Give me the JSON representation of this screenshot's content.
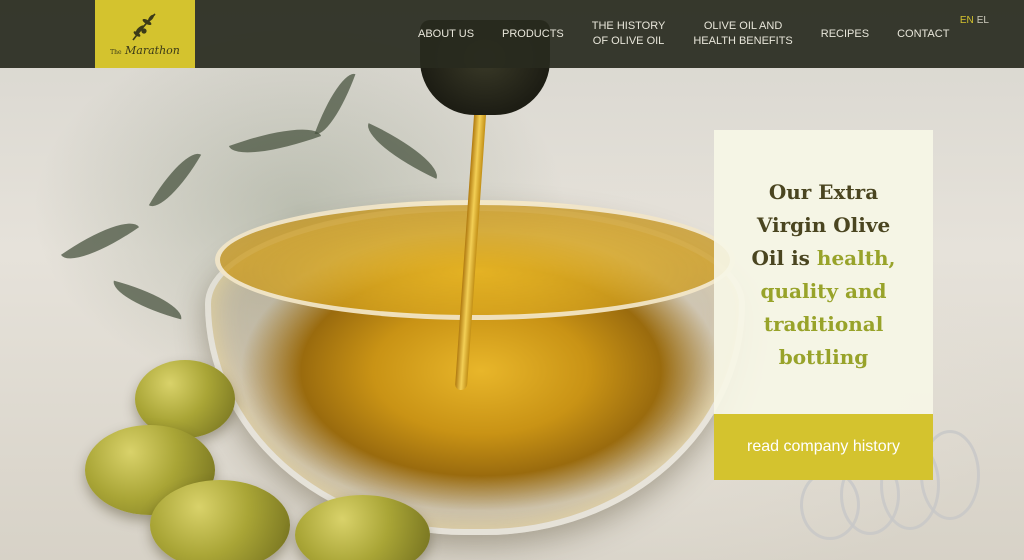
{
  "brand": {
    "logo_small": "The",
    "logo_name": "Marathon",
    "logo_colors": {
      "background": "#d4c32e",
      "ink": "#3b3a18"
    },
    "logo_icon": "olive-branch-icon"
  },
  "nav": {
    "items": [
      {
        "label": "ABOUT US"
      },
      {
        "label": "PRODUCTS"
      },
      {
        "label": "THE HISTORY\nOF OLIVE OIL"
      },
      {
        "label": "OLIVE OIL AND\nHEALTH BENEFITS"
      },
      {
        "label": "RECIPES"
      },
      {
        "label": "CONTACT"
      }
    ]
  },
  "language": {
    "active": "EN",
    "other": "EL"
  },
  "hero_card": {
    "text_main": "Our Extra Virgin Olive Oil is",
    "text_accent": "health, quality and traditional bottling",
    "button_label": "read company history"
  },
  "colors": {
    "navbar": "#282a1e",
    "accent_yellow": "#d4c32e",
    "accent_green": "#98a32a",
    "card_bg": "#f6f6e6"
  }
}
